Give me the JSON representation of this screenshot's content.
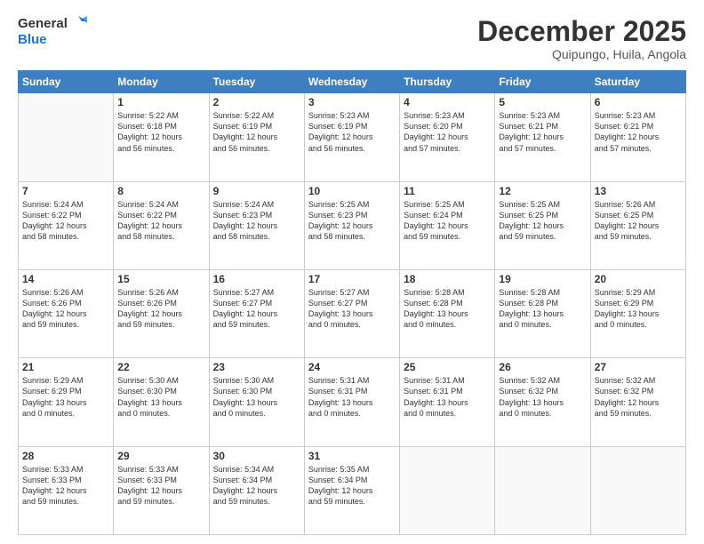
{
  "logo": {
    "line1": "General",
    "line2": "Blue"
  },
  "header": {
    "month": "December 2025",
    "location": "Quipungo, Huila, Angola"
  },
  "weekdays": [
    "Sunday",
    "Monday",
    "Tuesday",
    "Wednesday",
    "Thursday",
    "Friday",
    "Saturday"
  ],
  "weeks": [
    [
      {
        "day": "",
        "sunrise": "",
        "sunset": "",
        "daylight": ""
      },
      {
        "day": "1",
        "sunrise": "5:22 AM",
        "sunset": "6:18 PM",
        "daylight": "12 hours and 56 minutes."
      },
      {
        "day": "2",
        "sunrise": "5:22 AM",
        "sunset": "6:19 PM",
        "daylight": "12 hours and 56 minutes."
      },
      {
        "day": "3",
        "sunrise": "5:23 AM",
        "sunset": "6:19 PM",
        "daylight": "12 hours and 56 minutes."
      },
      {
        "day": "4",
        "sunrise": "5:23 AM",
        "sunset": "6:20 PM",
        "daylight": "12 hours and 57 minutes."
      },
      {
        "day": "5",
        "sunrise": "5:23 AM",
        "sunset": "6:21 PM",
        "daylight": "12 hours and 57 minutes."
      },
      {
        "day": "6",
        "sunrise": "5:23 AM",
        "sunset": "6:21 PM",
        "daylight": "12 hours and 57 minutes."
      }
    ],
    [
      {
        "day": "7",
        "sunrise": "5:24 AM",
        "sunset": "6:22 PM",
        "daylight": "12 hours and 58 minutes."
      },
      {
        "day": "8",
        "sunrise": "5:24 AM",
        "sunset": "6:22 PM",
        "daylight": "12 hours and 58 minutes."
      },
      {
        "day": "9",
        "sunrise": "5:24 AM",
        "sunset": "6:23 PM",
        "daylight": "12 hours and 58 minutes."
      },
      {
        "day": "10",
        "sunrise": "5:25 AM",
        "sunset": "6:23 PM",
        "daylight": "12 hours and 58 minutes."
      },
      {
        "day": "11",
        "sunrise": "5:25 AM",
        "sunset": "6:24 PM",
        "daylight": "12 hours and 59 minutes."
      },
      {
        "day": "12",
        "sunrise": "5:25 AM",
        "sunset": "6:25 PM",
        "daylight": "12 hours and 59 minutes."
      },
      {
        "day": "13",
        "sunrise": "5:26 AM",
        "sunset": "6:25 PM",
        "daylight": "12 hours and 59 minutes."
      }
    ],
    [
      {
        "day": "14",
        "sunrise": "5:26 AM",
        "sunset": "6:26 PM",
        "daylight": "12 hours and 59 minutes."
      },
      {
        "day": "15",
        "sunrise": "5:26 AM",
        "sunset": "6:26 PM",
        "daylight": "12 hours and 59 minutes."
      },
      {
        "day": "16",
        "sunrise": "5:27 AM",
        "sunset": "6:27 PM",
        "daylight": "12 hours and 59 minutes."
      },
      {
        "day": "17",
        "sunrise": "5:27 AM",
        "sunset": "6:27 PM",
        "daylight": "13 hours and 0 minutes."
      },
      {
        "day": "18",
        "sunrise": "5:28 AM",
        "sunset": "6:28 PM",
        "daylight": "13 hours and 0 minutes."
      },
      {
        "day": "19",
        "sunrise": "5:28 AM",
        "sunset": "6:28 PM",
        "daylight": "13 hours and 0 minutes."
      },
      {
        "day": "20",
        "sunrise": "5:29 AM",
        "sunset": "6:29 PM",
        "daylight": "13 hours and 0 minutes."
      }
    ],
    [
      {
        "day": "21",
        "sunrise": "5:29 AM",
        "sunset": "6:29 PM",
        "daylight": "13 hours and 0 minutes."
      },
      {
        "day": "22",
        "sunrise": "5:30 AM",
        "sunset": "6:30 PM",
        "daylight": "13 hours and 0 minutes."
      },
      {
        "day": "23",
        "sunrise": "5:30 AM",
        "sunset": "6:30 PM",
        "daylight": "13 hours and 0 minutes."
      },
      {
        "day": "24",
        "sunrise": "5:31 AM",
        "sunset": "6:31 PM",
        "daylight": "13 hours and 0 minutes."
      },
      {
        "day": "25",
        "sunrise": "5:31 AM",
        "sunset": "6:31 PM",
        "daylight": "13 hours and 0 minutes."
      },
      {
        "day": "26",
        "sunrise": "5:32 AM",
        "sunset": "6:32 PM",
        "daylight": "13 hours and 0 minutes."
      },
      {
        "day": "27",
        "sunrise": "5:32 AM",
        "sunset": "6:32 PM",
        "daylight": "12 hours and 59 minutes."
      }
    ],
    [
      {
        "day": "28",
        "sunrise": "5:33 AM",
        "sunset": "6:33 PM",
        "daylight": "12 hours and 59 minutes."
      },
      {
        "day": "29",
        "sunrise": "5:33 AM",
        "sunset": "6:33 PM",
        "daylight": "12 hours and 59 minutes."
      },
      {
        "day": "30",
        "sunrise": "5:34 AM",
        "sunset": "6:34 PM",
        "daylight": "12 hours and 59 minutes."
      },
      {
        "day": "31",
        "sunrise": "5:35 AM",
        "sunset": "6:34 PM",
        "daylight": "12 hours and 59 minutes."
      },
      {
        "day": "",
        "sunrise": "",
        "sunset": "",
        "daylight": ""
      },
      {
        "day": "",
        "sunrise": "",
        "sunset": "",
        "daylight": ""
      },
      {
        "day": "",
        "sunrise": "",
        "sunset": "",
        "daylight": ""
      }
    ]
  ]
}
